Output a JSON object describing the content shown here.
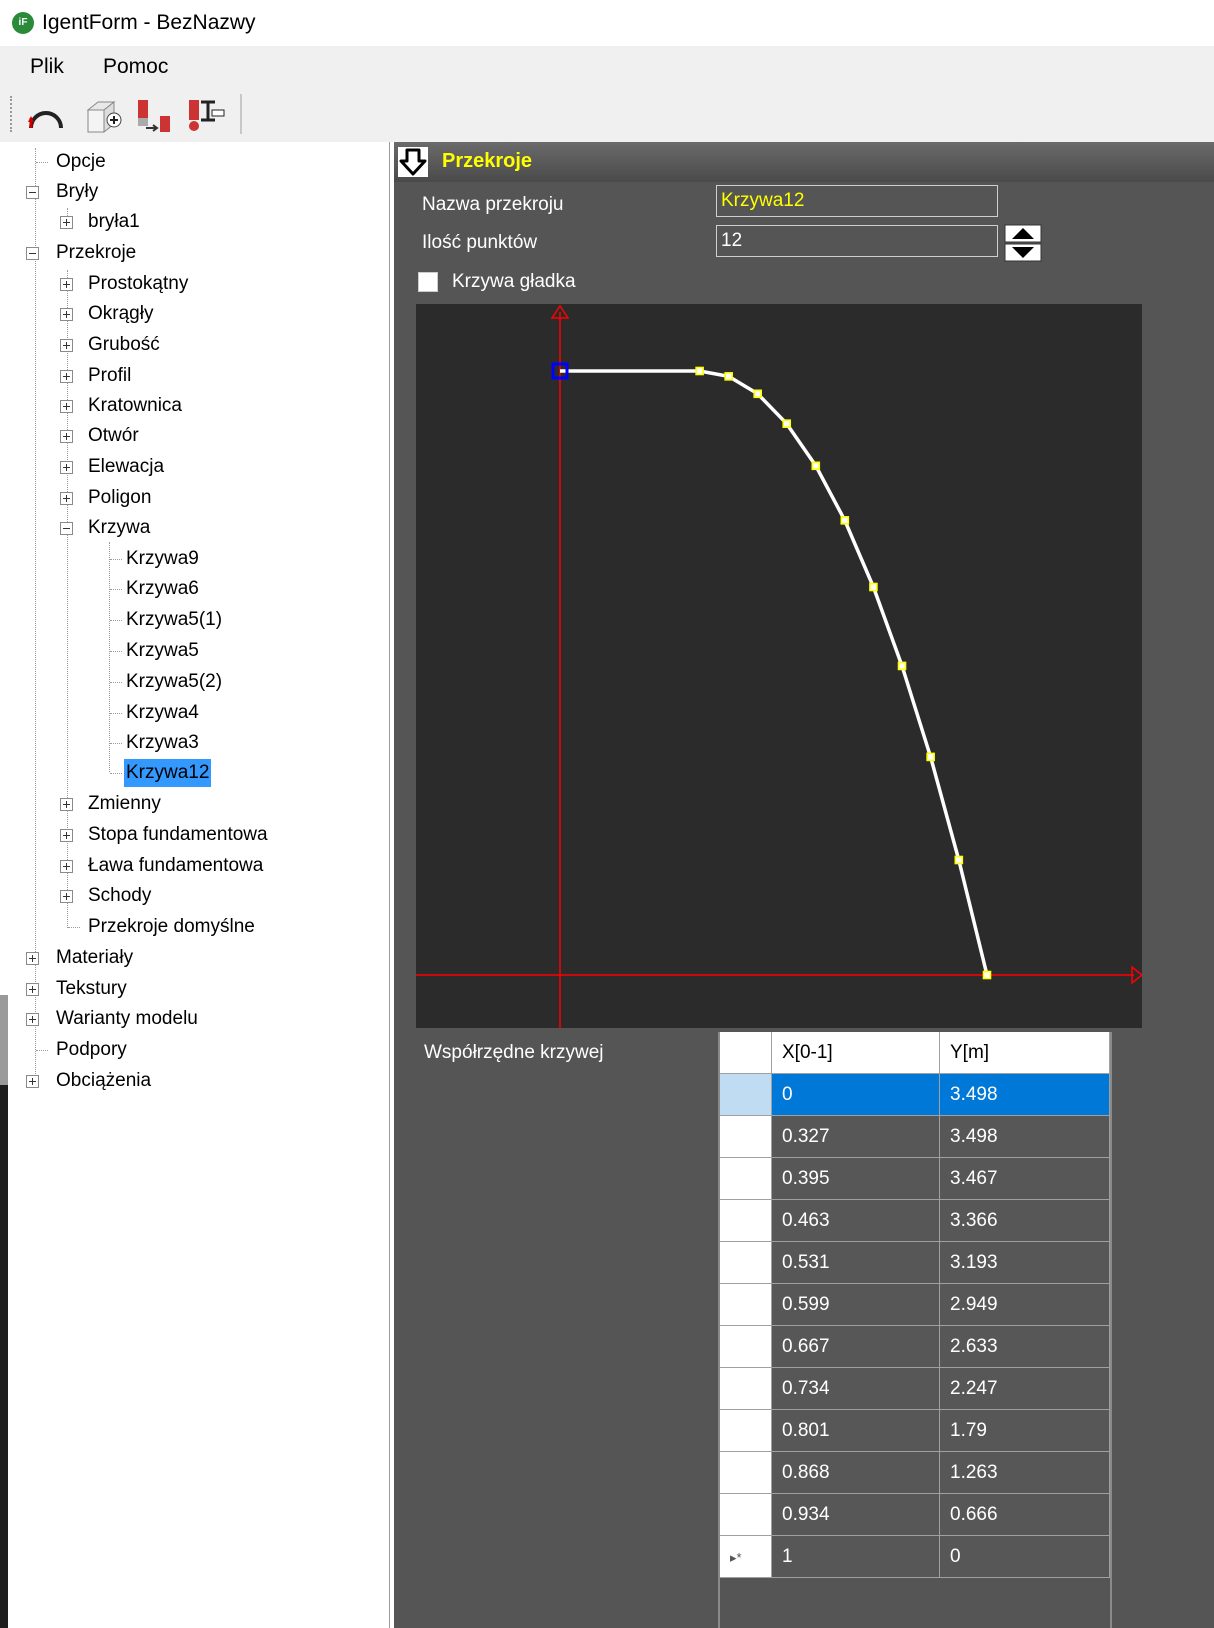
{
  "window": {
    "title": "IgentForm - BezNazwy",
    "icon": "app-logo-icon"
  },
  "menu": {
    "items": [
      "Plik",
      "Pomoc"
    ]
  },
  "toolbar": {
    "buttons": [
      {
        "name": "arch-curve-button",
        "icon": "arch-icon"
      },
      {
        "name": "add-solid-button",
        "icon": "cube-add-icon"
      },
      {
        "name": "copy-section-button",
        "icon": "section-copy-icon"
      },
      {
        "name": "section-profile-button",
        "icon": "i-beam-icon"
      }
    ]
  },
  "tree": {
    "opcje": "Opcje",
    "bryly": "Bryły",
    "bryla1": "bryła1",
    "przekroje": "Przekroje",
    "prostokatny": "Prostokątny",
    "okragly": "Okrągły",
    "grubosc": "Grubość",
    "profil": "Profil",
    "kratownica": "Kratownica",
    "otwor": "Otwór",
    "elewacja": "Elewacja",
    "poligon": "Poligon",
    "krzywa": "Krzywa",
    "krzywa9": "Krzywa9",
    "krzywa6": "Krzywa6",
    "krzywa5_1": "Krzywa5(1)",
    "krzywa5": "Krzywa5",
    "krzywa5_2": "Krzywa5(2)",
    "krzywa4": "Krzywa4",
    "krzywa3": "Krzywa3",
    "krzywa12": "Krzywa12",
    "zmienny": "Zmienny",
    "stopa": "Stopa fundamentowa",
    "lawa": "Ława fundamentowa",
    "schody": "Schody",
    "domyslne": "Przekroje domyślne",
    "materialy": "Materiały",
    "tekstury": "Tekstury",
    "warianty": "Warianty modelu",
    "podpory": "Podpory",
    "obciazenia": "Obciążenia"
  },
  "panel": {
    "title": "Przekroje",
    "name_label": "Nazwa przekroju",
    "name_value": "Krzywa12",
    "points_label": "Ilość punktów",
    "points_value": "12",
    "smooth_label": "Krzywa gładka",
    "smooth_checked": false,
    "coords_label": "Współrzędne krzywej",
    "colors": {
      "title": "#ffff00",
      "axis": "#ff0000",
      "curve": "#ffffff",
      "point": "#ffff00",
      "first_point": "#0000ff"
    }
  },
  "grid": {
    "headers": {
      "x": "X[0-1]",
      "y": "Y[m]"
    },
    "new_row_marker": "▸*",
    "rows": [
      {
        "x": "0",
        "y": "3.498"
      },
      {
        "x": "0.327",
        "y": "3.498"
      },
      {
        "x": "0.395",
        "y": "3.467"
      },
      {
        "x": "0.463",
        "y": "3.366"
      },
      {
        "x": "0.531",
        "y": "3.193"
      },
      {
        "x": "0.599",
        "y": "2.949"
      },
      {
        "x": "0.667",
        "y": "2.633"
      },
      {
        "x": "0.734",
        "y": "2.247"
      },
      {
        "x": "0.801",
        "y": "1.79"
      },
      {
        "x": "0.868",
        "y": "1.263"
      },
      {
        "x": "0.934",
        "y": "0.666"
      },
      {
        "x": "1",
        "y": "0"
      }
    ],
    "selected_row": 0
  }
}
